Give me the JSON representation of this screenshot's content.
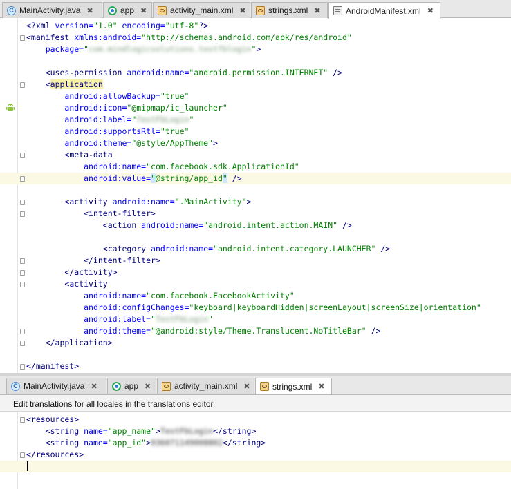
{
  "top_tabs": [
    {
      "label": "MainActivity.java",
      "icon": "java-class-icon",
      "active": false
    },
    {
      "label": "app",
      "icon": "module-icon",
      "active": false
    },
    {
      "label": "activity_main.xml",
      "icon": "xml-layout-icon",
      "active": false
    },
    {
      "label": "strings.xml",
      "icon": "xml-values-icon",
      "active": false
    },
    {
      "label": "AndroidManifest.xml",
      "icon": "manifest-icon",
      "active": true
    }
  ],
  "manifest_lines": [
    "<?xml version=\"1.0\" encoding=\"utf-8\"?>",
    "<manifest xmlns:android=\"http://schemas.android.com/apk/res/android\"",
    "    package=\"com.mindlogicsolutions.testfblogin\">",
    "",
    "    <uses-permission android:name=\"android.permission.INTERNET\" />",
    "    <application",
    "        android:allowBackup=\"true\"",
    "        android:icon=\"@mipmap/ic_launcher\"",
    "        android:label=\"TestFbLogin\"",
    "        android:supportsRtl=\"true\"",
    "        android:theme=\"@style/AppTheme\">",
    "        <meta-data",
    "            android:name=\"com.facebook.sdk.ApplicationId\"",
    "            android:value=\"@string/app_id\" />",
    "",
    "        <activity android:name=\".MainActivity\">",
    "            <intent-filter>",
    "                <action android:name=\"android.intent.action.MAIN\" />",
    "",
    "                <category android:name=\"android.intent.category.LAUNCHER\" />",
    "            </intent-filter>",
    "        </activity>",
    "        <activity",
    "            android:name=\"com.facebook.FacebookActivity\"",
    "            android:configChanges=\"keyboard|keyboardHidden|screenLayout|screenSize|orientation\"",
    "            android:label=\"TestFbLogin\"",
    "            android:theme=\"@android:style/Theme.Translucent.NoTitleBar\" />",
    "    </application>",
    "",
    "</manifest>"
  ],
  "bottom_tabs": [
    {
      "label": "MainActivity.java",
      "icon": "java-class-icon",
      "active": false
    },
    {
      "label": "app",
      "icon": "module-icon",
      "active": false
    },
    {
      "label": "activity_main.xml",
      "icon": "xml-layout-icon",
      "active": false
    },
    {
      "label": "strings.xml",
      "icon": "xml-values-icon",
      "active": true
    }
  ],
  "translations_banner": "Edit translations for all locales in the translations editor.",
  "strings_lines": [
    "<resources>",
    "    <string name=\"app_name\">TestFbLogin</string>",
    "    <string name=\"app_id\">936071149008802</string>",
    "</resources>",
    ""
  ],
  "close_glyph": "✖",
  "colors": {
    "tag": "#000080",
    "attribute": "#0000ff",
    "value": "#008000",
    "highlight": "#fbf9e3"
  }
}
